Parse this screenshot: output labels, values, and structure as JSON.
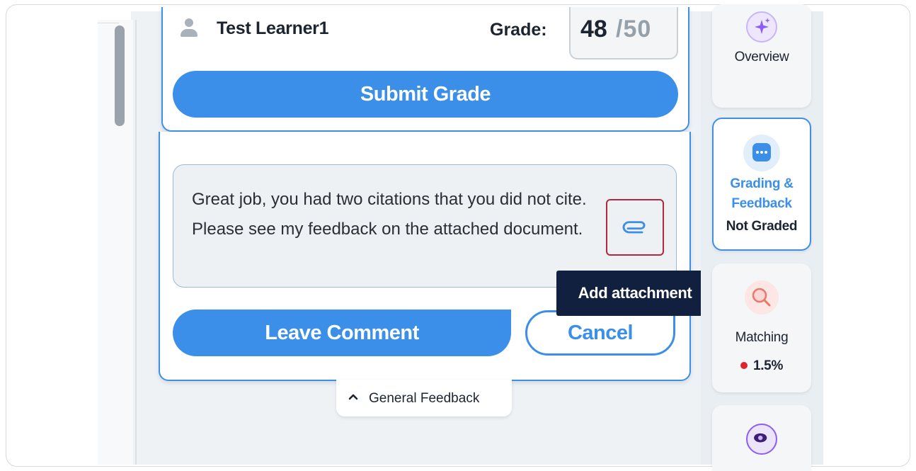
{
  "learner": {
    "name": "Test Learner1"
  },
  "grade": {
    "label": "Grade:",
    "value": "48",
    "max": "/50"
  },
  "submit": {
    "label": "Submit Grade"
  },
  "comment": {
    "text": "Great job, you had two citations that you did not cite. Please see my feedback on the attached document.",
    "leave_label": "Leave Comment",
    "cancel_label": "Cancel",
    "attach_tooltip": "Add attachment"
  },
  "general_feedback": {
    "label": "General Feedback",
    "icon": "chevron-up-icon"
  },
  "side_nav": {
    "overview": {
      "label": "Overview",
      "icon": "sparkle-icon"
    },
    "grading": {
      "label_line1": "Grading &",
      "label_line2": "Feedback",
      "status": "Not Graded",
      "icon": "chat-bubble-icon"
    },
    "matching": {
      "label": "Matching",
      "value": "1.5%",
      "icon": "magnifier-icon"
    },
    "viewer": {
      "icon": "eye-icon"
    }
  },
  "colors": {
    "accent": "#3c8fe8",
    "tooltip_bg": "#12203f",
    "highlight": "#b4283f",
    "alert_red": "#e0242e",
    "purple": "#8b5cf6"
  }
}
